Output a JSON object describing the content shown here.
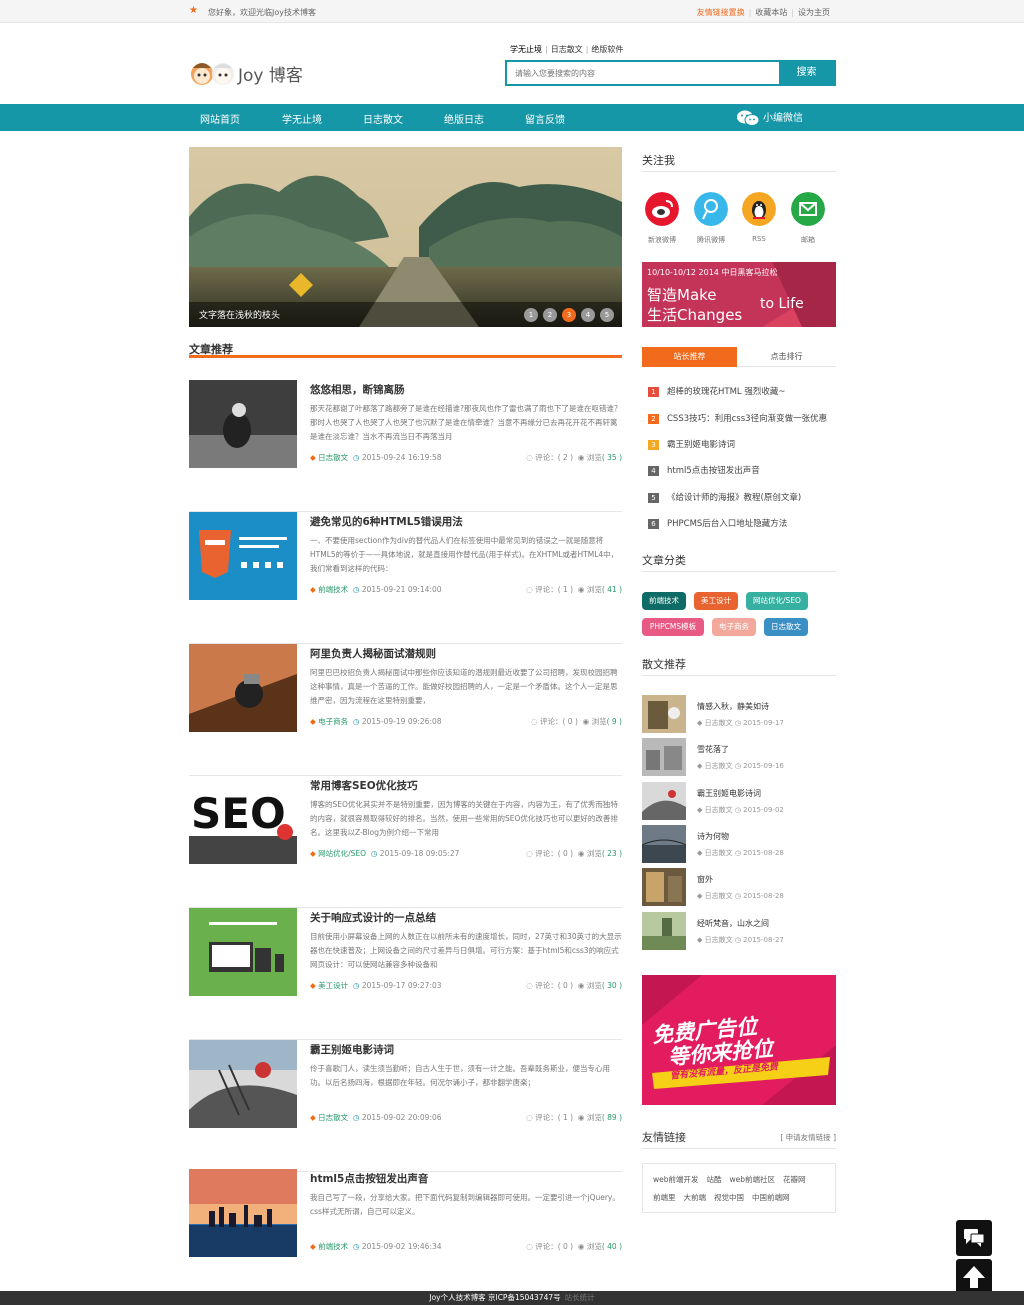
{
  "topbar": {
    "welcome": "您好象，欢迎光临Joy技术博客",
    "links": [
      "友情链接置换",
      "收藏本站",
      "设为主页"
    ]
  },
  "header": {
    "logo_text": "Joy 博客",
    "quick_links": [
      "学无止境",
      "日志散文",
      "绝版软件"
    ],
    "search_placeholder": "请输入您要搜索的内容",
    "search_button": "搜索"
  },
  "nav": {
    "items": [
      "网站首页",
      "学无止境",
      "日志散文",
      "绝版日志",
      "留言反馈"
    ],
    "wechat": "小编微信"
  },
  "banner": {
    "caption": "文字落在浅秋的枝头",
    "dots": [
      "1",
      "2",
      "3",
      "4",
      "5"
    ],
    "active_dot": 3
  },
  "main": {
    "section_title": "文章推荐",
    "articles": [
      {
        "title": "悠悠相思，断锦离肠",
        "desc": "那天花都谢了叶都落了路都旁了是谁在经描谁?那夜风也作了雷也满了雨也下了是谁在呕错谁？那时人也哭了人也哭了人也哭了也沉默了是谁在情牵谁？当意不再缘分已去再花开花不再轩篱是谁在淡忘谁？当水不再流当日不再落当月",
        "category": "日志散文",
        "date": "2015-09-24 16:19:58",
        "comments": "评论：( 2 )",
        "views_label": "浏览",
        "views": "( 35 )"
      },
      {
        "title": "避免常见的6种HTML5错误用法",
        "desc": "一、不要使用section作为div的替代品人们在标签使用中最常见到的错误之一就是随意将HTML5的等价于——具体地说，就是直接用作替代品(用于样式)。在XHTML或者HTML4中，我们常看到这样的代码：",
        "category": "前端技术",
        "date": "2015-09-21 09:14:00",
        "comments": "评论：( 1 )",
        "views_label": "浏览",
        "views": "( 41 )"
      },
      {
        "title": "阿里负责人揭秘面试潜规则",
        "desc": "阿里巴巴校招负责人揭秘面试中那些你应该知道的潜规则最近收要了公司招聘，发现校园招聘这种事情，真是一个苦逼的工作。能做好校园招聘的人，一定是一个矛盾体。这个人一定是思维严密，因为流程在这里特别重要，",
        "category": "电子商务",
        "date": "2015-09-19 09:26:08",
        "comments": "评论：( 0 )",
        "views_label": "浏览",
        "views": "( 9 )"
      },
      {
        "title": "常用博客SEO优化技巧",
        "desc": "博客的SEO优化其实并不是特别重要，因为博客的关键在于内容，内容为王，有了优秀而独特的内容，就很容易取得较好的排名。当然，使用一些常用的SEO优化技巧也可以更好的改善排名。这里我以Z-Blog为例介绍一下常用",
        "category": "网站优化/SEO",
        "date": "2015-09-18 09:05:27",
        "comments": "评论：( 0 )",
        "views_label": "浏览",
        "views": "( 23 )"
      },
      {
        "title": "关于响应式设计的一点总结",
        "desc": "目前使用小屏幕设备上网的人数正在以前所未有的速度增长，同时，27英寸和30英寸的大显示器也在快速普及；上网设备之间的尺寸差异与日俱增。可行方案：基于html5和css3的响应式网页设计：可以使网站兼容多种设备和",
        "category": "美工设计",
        "date": "2015-09-17 09:27:03",
        "comments": "评论：( 0 )",
        "views_label": "浏览",
        "views": "( 30 )"
      },
      {
        "title": "霸王别姬电影诗词",
        "desc": "伶于喜歌门人，读生须当勤听；自古人生于世，须有一计之能。吾辈既务斯业，便当专心用功。以后名扬四海，根据即在年轻。何况尔诵小子，都非翻学唐楽；",
        "category": "日志散文",
        "date": "2015-09-02 20:09:06",
        "comments": "评论：( 1 )",
        "views_label": "浏览",
        "views": "( 89 )"
      },
      {
        "title": "html5点击按钮发出声音",
        "desc": "我自己写了一段，分享给大家。把下面代码复制到编辑器即可使用。一定要引进一个jQuery。css样式无所谓，自己可以定义。",
        "category": "前端技术",
        "date": "2015-09-02 19:46:34",
        "comments": "评论：( 0 )",
        "views_label": "浏览",
        "views": "( 40 )"
      }
    ]
  },
  "sidebar": {
    "follow_title": "关注我",
    "follow": [
      {
        "label": "新浪微博",
        "color": "#e6162d"
      },
      {
        "label": "腾讯微博",
        "color": "#38b7ea"
      },
      {
        "label": "RSS",
        "color": "#f5a623"
      },
      {
        "label": "邮箱",
        "color": "#26a846"
      }
    ],
    "ad1_text": [
      "10/10-10/12 2014 中日黑客马拉松",
      "智造Make",
      "生活Changes",
      "to Life"
    ],
    "tabs": [
      "站长推荐",
      "点击排行"
    ],
    "rank": [
      {
        "n": "1",
        "title": "超棒的玫瑰花HTML 强烈收藏~",
        "color": "#e84c3d"
      },
      {
        "n": "2",
        "title": "CSS3技巧：利用css3径向渐变做一张优惠",
        "color": "#f26a1b"
      },
      {
        "n": "3",
        "title": "霸王别姬电影诗词",
        "color": "#f5a623"
      },
      {
        "n": "4",
        "title": "html5点击按钮发出声音",
        "color": "#666666"
      },
      {
        "n": "5",
        "title": "《给设计师的海报》教程(原创文章)",
        "color": "#666666"
      },
      {
        "n": "6",
        "title": "PHPCMS后台入口地址隐藏方法",
        "color": "#666666"
      }
    ],
    "categories_title": "文章分类",
    "categories": [
      {
        "label": "前端技术",
        "color": "#0e6b66"
      },
      {
        "label": "美工设计",
        "color": "#e8632f"
      },
      {
        "label": "网站优化/SEO",
        "color": "#36b0a0"
      },
      {
        "label": "PHPCMS模板",
        "color": "#e85a84"
      },
      {
        "label": "电子商务",
        "color": "#f2a99c"
      },
      {
        "label": "日志散文",
        "color": "#3a8fc4"
      }
    ],
    "prose_title": "散文推荐",
    "prose": [
      {
        "title": "情感入秋，静美如诗",
        "cat": "日志散文",
        "date": "2015-09-17"
      },
      {
        "title": "雪花落了",
        "cat": "日志散文",
        "date": "2015-09-16"
      },
      {
        "title": "霸王别姬电影诗词",
        "cat": "日志散文",
        "date": "2015-09-02"
      },
      {
        "title": "诗为何物",
        "cat": "日志散文",
        "date": "2015-08-28"
      },
      {
        "title": "窗外",
        "cat": "日志散文",
        "date": "2015-08-28"
      },
      {
        "title": "经听梵音，山水之间",
        "cat": "日志散文",
        "date": "2015-08-27"
      }
    ],
    "ad2_text": [
      "免费广告位",
      "等你来抢位",
      "管有没有流量，反正是免费"
    ],
    "friends_title": "友情链接",
    "friends_apply": "[ 申请友情链接 ]",
    "friends_row1": [
      "web前端开发",
      "站酷",
      "web前端社区",
      "花瓣网"
    ],
    "friends_row2": [
      "前端里",
      "大前端",
      "视觉中国",
      "中国前端网"
    ]
  },
  "footer": {
    "text": "Joy个人技术博客 京ICP备15043747号",
    "stat": "站长统计"
  }
}
